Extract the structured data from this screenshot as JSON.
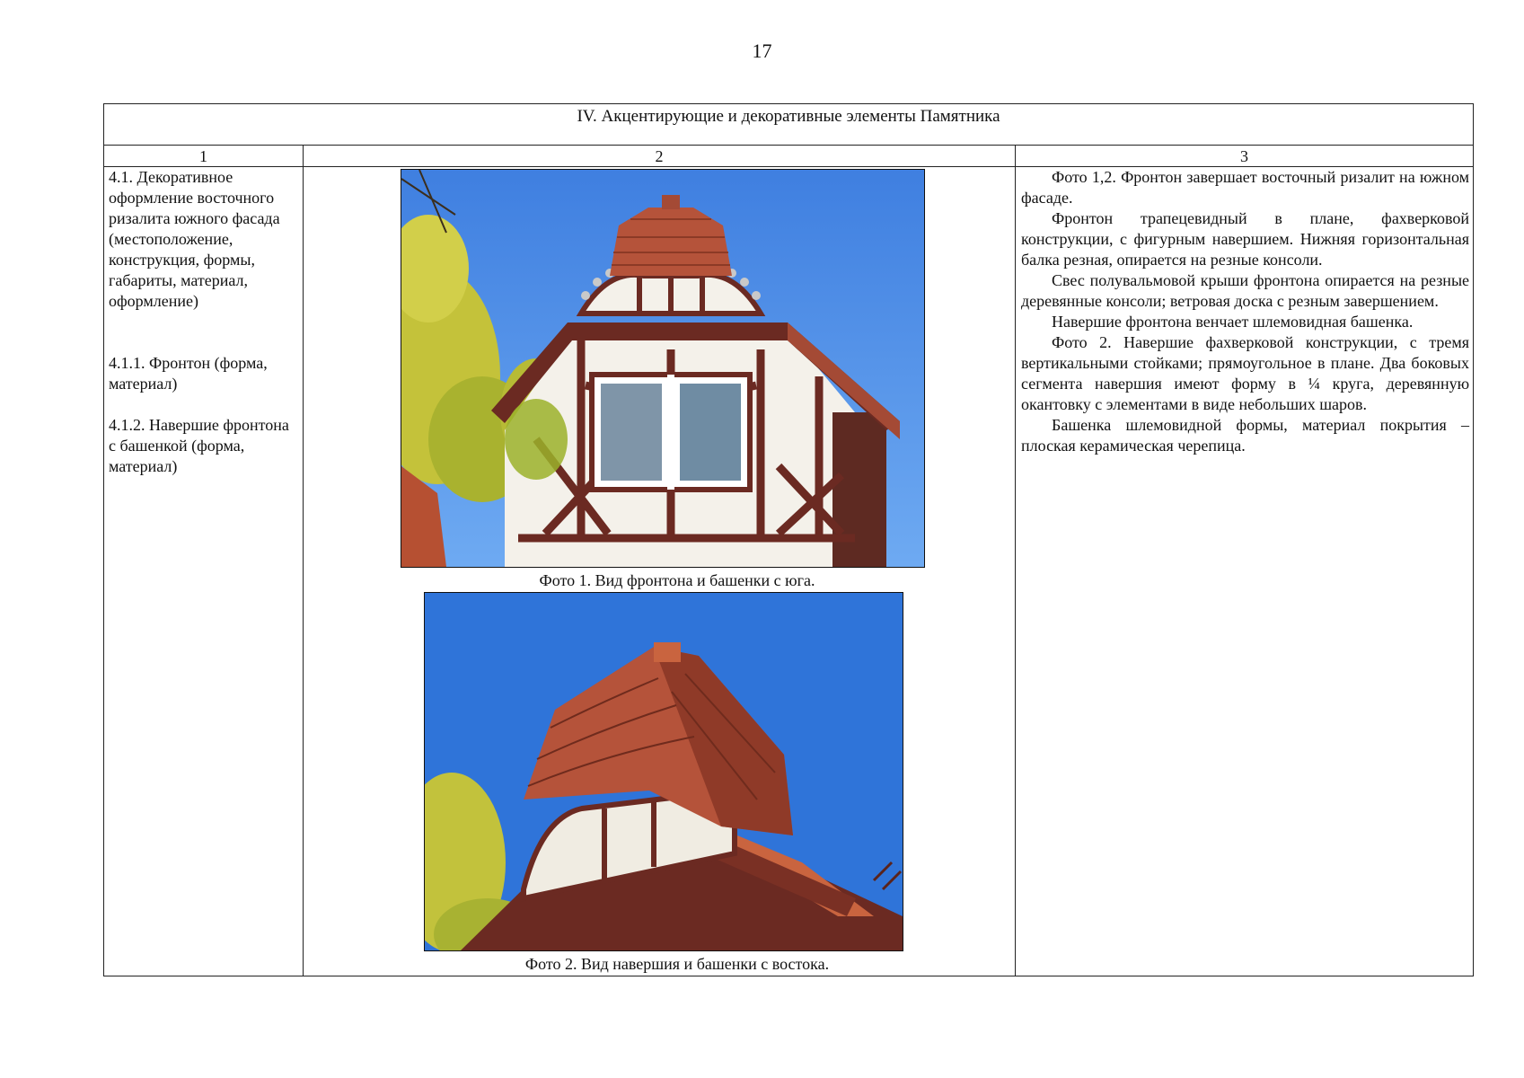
{
  "page": {
    "number": "17"
  },
  "table": {
    "section_title": "IV.  Акцентирующие и декоративные элементы Памятника",
    "column_headers": [
      "1",
      "2",
      "3"
    ],
    "col1": {
      "item_4_1": "4.1. Декоративное оформление восточного ризалита южного фасада (местоположение, конструкция, формы, габариты, материал, оформление)",
      "item_4_1_1": "4.1.1. Фронтон (форма, материал)",
      "item_4_1_2": "4.1.2. Навершие фронтона с башенкой (форма, материал)"
    },
    "col2": {
      "photo1_caption": "Фото 1. Вид фронтона и башенки с юга.",
      "photo2_caption": "Фото 2. Вид навершия и башенки с востока."
    },
    "col3": {
      "paragraphs": [
        "Фото 1,2. Фронтон завершает восточный ризалит на южном фасаде.",
        "Фронтон трапецевидный в плане, фахверковой конструкции, с фигурным навершием. Нижняя горизонтальная балка резная, опирается на резные консоли.",
        "Свес полувальмовой крыши фронтона опирается на резные деревянные консоли; ветровая доска с резным завершением.",
        "Навершие фронтона венчает шлемовидная башенка.",
        "Фото 2. Навершие фахверковой конструкции, с тремя вертикальными стойками; прямоугольное в плане. Два боковых сегмента навершия имеют форму в ¼ круга, деревянную окантовку с элементами в виде небольших шаров.",
        "Башенка шлемовидной формы, материал покрытия – плоская керамическая черепица."
      ]
    }
  },
  "colors": {
    "sky": "#3f86e6",
    "tile": "#b5533a",
    "timber": "#6b2a22",
    "plaster": "#f4f1ea",
    "foliage": "#c9c53a"
  }
}
